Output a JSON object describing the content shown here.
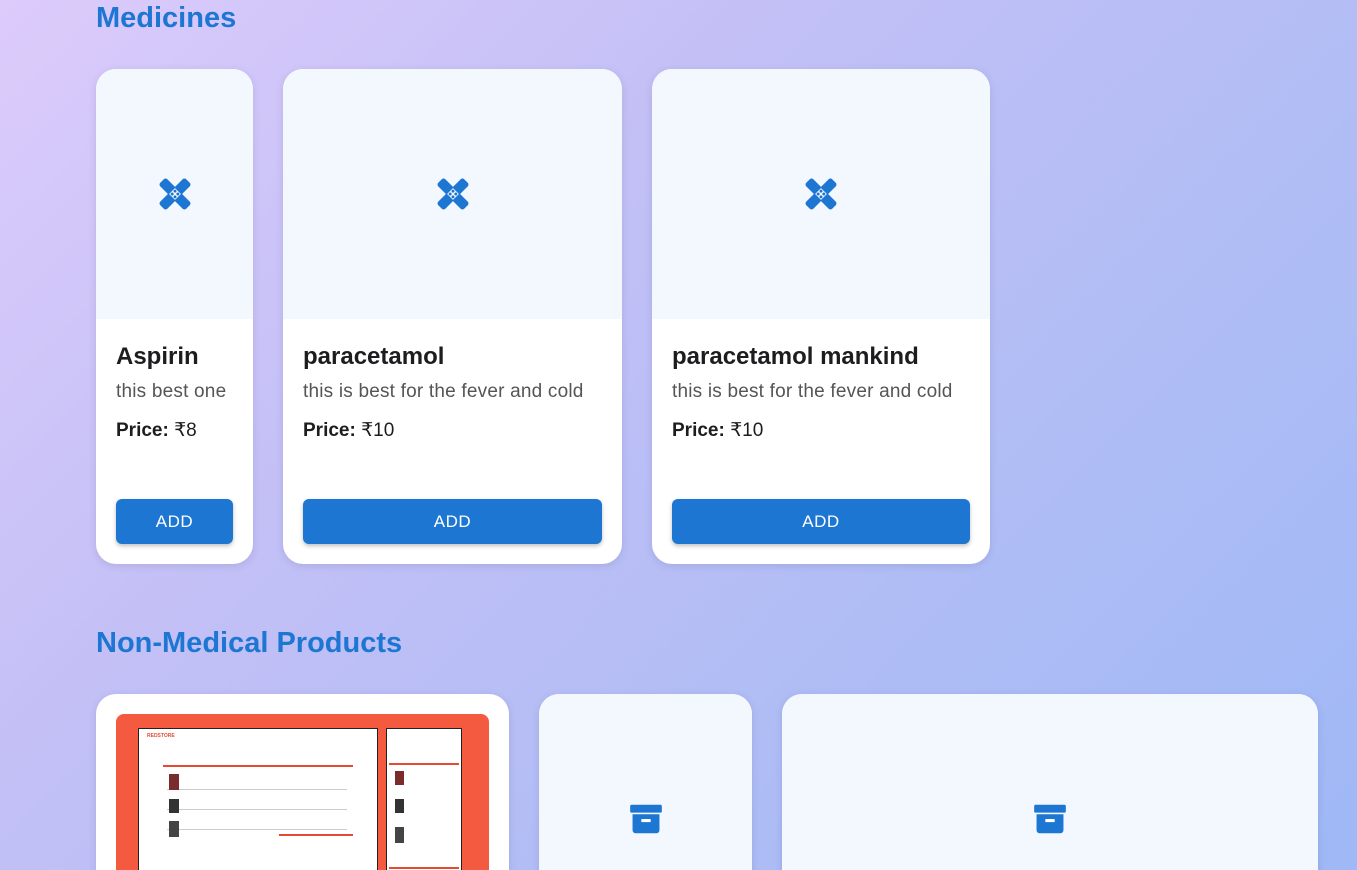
{
  "sections": {
    "medicines_title": "Medicines",
    "non_medical_title": "Non-Medical Products"
  },
  "medicines": [
    {
      "name": "Aspirin",
      "description": "this best one",
      "price_label": "Price:",
      "price": "₹8",
      "button": "ADD",
      "icon": "bandage-icon"
    },
    {
      "name": "paracetamol",
      "description": "this is best for the fever and cold",
      "price_label": "Price:",
      "price": "₹10",
      "button": "ADD",
      "icon": "bandage-icon"
    },
    {
      "name": "paracetamol mankind",
      "description": "this is best for the fever and cold",
      "price_label": "Price:",
      "price": "₹10",
      "button": "ADD",
      "icon": "bandage-icon"
    }
  ],
  "non_medical": [
    {
      "image": "store-cart-screenshot",
      "brand_text": "REDSTORE"
    },
    {
      "icon": "archive-box-icon"
    },
    {
      "icon": "archive-box-icon"
    }
  ],
  "colors": {
    "accent": "#1c76d2",
    "card_image_bg": "#f3f8fe",
    "screenshot_bg": "#f45a40"
  }
}
